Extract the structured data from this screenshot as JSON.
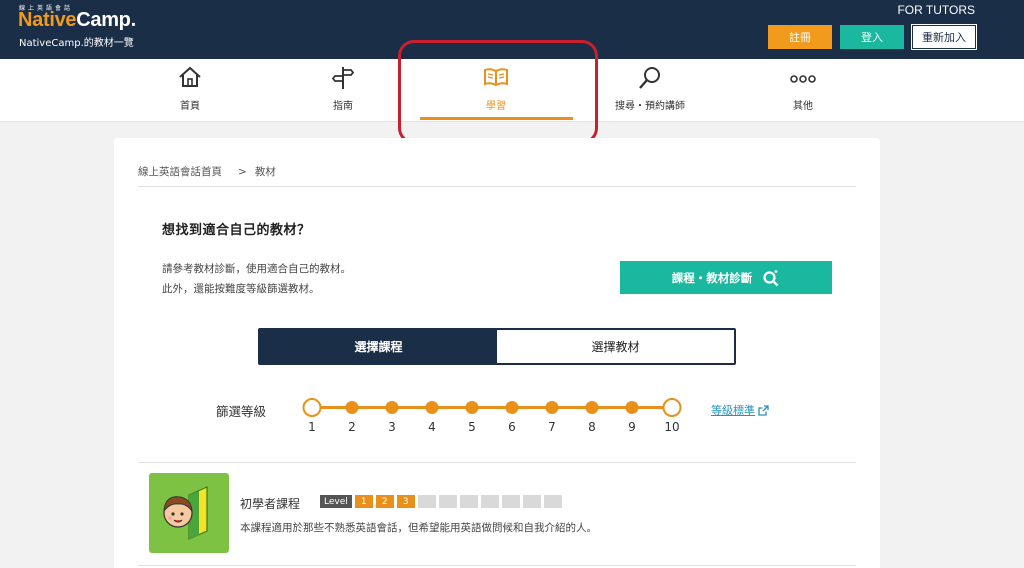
{
  "header": {
    "logo_small": "線上英語會話",
    "logo_native": "Native",
    "logo_camp": "Camp.",
    "subtitle": "NativeCamp.的教材一覽",
    "for_tutors": "FOR TUTORS",
    "register_label": "註冊",
    "login_label": "登入",
    "rejoin_label": "重新加入",
    "colors": {
      "navy": "#1a2e48",
      "orange": "#f19a1b",
      "teal": "#1ab89e"
    }
  },
  "nav": {
    "items": [
      {
        "label": "首頁",
        "icon": "home-icon"
      },
      {
        "label": "指南",
        "icon": "signpost-icon"
      },
      {
        "label": "學習",
        "icon": "book-icon",
        "active": true
      },
      {
        "label": "搜尋・預約講師",
        "icon": "search-icon"
      },
      {
        "label": "其他",
        "icon": "more-icon"
      }
    ]
  },
  "breadcrumb": {
    "home": "線上英語會話首頁",
    "separator": ">",
    "current": "教材"
  },
  "intro": {
    "title": "想找到適合自己的教材？",
    "desc_line1": "請參考教材診斷，使用適合自己的教材。",
    "desc_line2": "此外，還能按難度等級篩選教材。",
    "diagnosis_button": "課程・教材診斷"
  },
  "toggle": {
    "courses": "選擇課程",
    "materials": "選擇教材",
    "selected": "courses"
  },
  "filter": {
    "label": "篩選等級",
    "levels": [
      "1",
      "2",
      "3",
      "4",
      "5",
      "6",
      "7",
      "8",
      "9",
      "10"
    ],
    "range": [
      1,
      10
    ],
    "level_standard_link": "等級標準"
  },
  "courses": [
    {
      "name": "初學者課程",
      "level_tag": "Level",
      "levels": [
        "1",
        "2",
        "3",
        "",
        "",
        "",
        "",
        "",
        "",
        ""
      ],
      "active_levels": 3,
      "description": "本課程適用於那些不熟悉英語會話，但希望能用英語做問候和自我介紹的人。"
    }
  ]
}
